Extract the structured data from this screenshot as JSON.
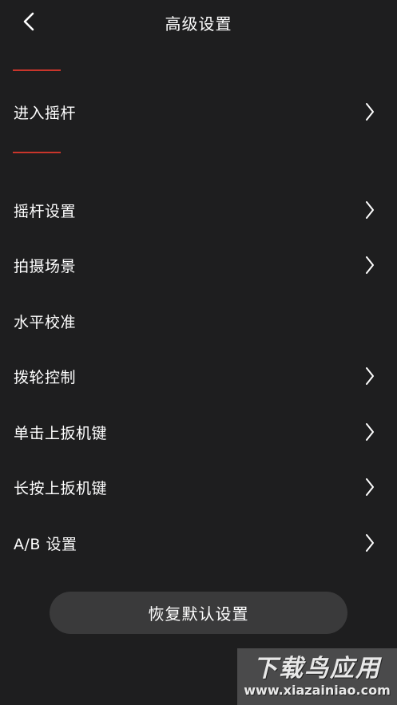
{
  "header": {
    "title": "高级设置",
    "back_icon": "chevron-left-icon"
  },
  "menu": {
    "items": [
      {
        "label": "进入摇杆",
        "has_chevron": true
      },
      {
        "label": "摇杆设置",
        "has_chevron": true
      },
      {
        "label": "拍摄场景",
        "has_chevron": true
      },
      {
        "label": "水平校准",
        "has_chevron": false
      },
      {
        "label": "拨轮控制",
        "has_chevron": true
      },
      {
        "label": "单击上扳机键",
        "has_chevron": true
      },
      {
        "label": "长按上扳机键",
        "has_chevron": true
      },
      {
        "label": "A/B 设置",
        "has_chevron": true
      }
    ]
  },
  "restore_button": {
    "label": "恢复默认设置"
  },
  "watermark": {
    "title": "下载鸟应用",
    "url": "www.xiazainiao.com"
  },
  "colors": {
    "background": "#1e1e1f",
    "accent_red": "#c9352b",
    "button_bg": "#3a3a3b",
    "text": "#ffffff"
  }
}
